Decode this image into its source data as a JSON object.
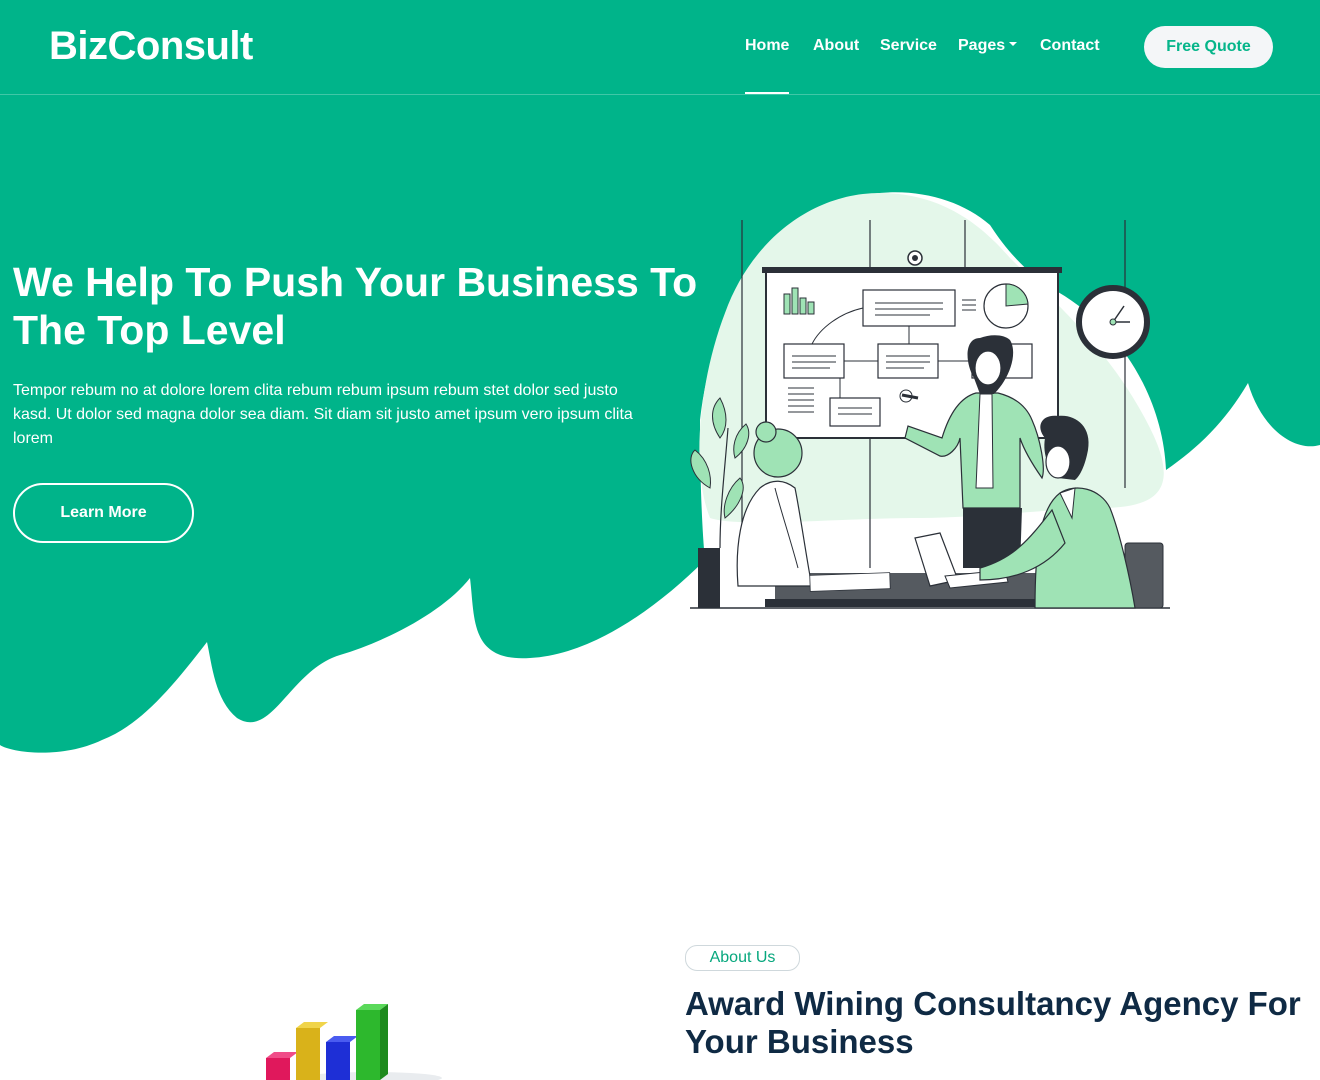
{
  "colors": {
    "brand": "#00B48A",
    "white": "#FFFFFF",
    "heading_dark": "#0F2A44",
    "illustration_green": "#9FE3B5"
  },
  "navbar": {
    "brand": "BizConsult",
    "items": [
      {
        "label": "Home",
        "active": true
      },
      {
        "label": "About"
      },
      {
        "label": "Service"
      },
      {
        "label": "Pages",
        "has_dropdown": true
      },
      {
        "label": "Contact"
      }
    ],
    "cta_label": "Free Quote"
  },
  "hero": {
    "title": "We Help To Push Your Business To The Top Level",
    "text": "Tempor rebum no at dolore lorem clita rebum rebum ipsum rebum stet dolor sed justo kasd. Ut dolor sed magna dolor sea diam. Sit diam sit justo amet ipsum vero ipsum clita lorem",
    "button_label": "Learn More"
  },
  "about": {
    "badge": "About Us",
    "title": "Award Wining Consultancy Agency For Your Business"
  }
}
